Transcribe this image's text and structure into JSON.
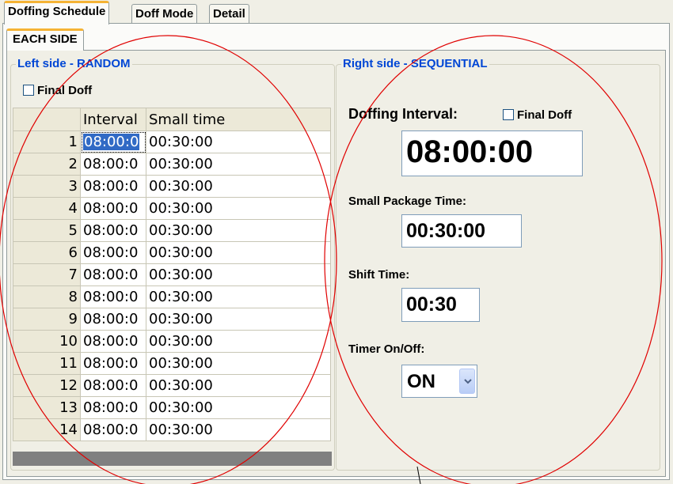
{
  "tabs": [
    {
      "label": "Doffing Schedule",
      "active": true
    },
    {
      "label": "Doff Mode",
      "active": false
    },
    {
      "label": "Detail",
      "active": false
    }
  ],
  "subtab": {
    "label": "EACH SIDE"
  },
  "left_group": {
    "title": "Left side - RANDOM",
    "final_doff_label": "Final Doff",
    "final_doff_checked": false
  },
  "grid": {
    "columns": [
      "Interval",
      "Small time"
    ],
    "rows": [
      {
        "n": "1",
        "interval": "08:00:0",
        "small": "00:30:00"
      },
      {
        "n": "2",
        "interval": "08:00:0",
        "small": "00:30:00"
      },
      {
        "n": "3",
        "interval": "08:00:0",
        "small": "00:30:00"
      },
      {
        "n": "4",
        "interval": "08:00:0",
        "small": "00:30:00"
      },
      {
        "n": "5",
        "interval": "08:00:0",
        "small": "00:30:00"
      },
      {
        "n": "6",
        "interval": "08:00:0",
        "small": "00:30:00"
      },
      {
        "n": "7",
        "interval": "08:00:0",
        "small": "00:30:00"
      },
      {
        "n": "8",
        "interval": "08:00:0",
        "small": "00:30:00"
      },
      {
        "n": "9",
        "interval": "08:00:0",
        "small": "00:30:00"
      },
      {
        "n": "10",
        "interval": "08:00:0",
        "small": "00:30:00"
      },
      {
        "n": "11",
        "interval": "08:00:0",
        "small": "00:30:00"
      },
      {
        "n": "12",
        "interval": "08:00:0",
        "small": "00:30:00"
      },
      {
        "n": "13",
        "interval": "08:00:0",
        "small": "00:30:00"
      },
      {
        "n": "14",
        "interval": "08:00:0",
        "small": "00:30:00"
      }
    ]
  },
  "right_group": {
    "title": "Right side - SEQUENTIAL",
    "doffing_interval_label": "Doffing Interval:",
    "final_doff_label": "Final Doff",
    "final_doff_checked": false,
    "doffing_interval_value": "08:00:00",
    "small_package_label": "Small Package Time:",
    "small_package_value": "00:30:00",
    "shift_time_label": "Shift Time:",
    "shift_time_value": "00:30",
    "timer_label": "Timer On/Off:",
    "timer_value": "ON"
  },
  "colors": {
    "legend": "#0046d5",
    "selection": "#316ac5",
    "annotation": "#e00000",
    "tab_highlight": "#f5b335"
  },
  "icons": {
    "dropdown": "chevron-down-icon",
    "checkbox": "checkbox-icon"
  }
}
